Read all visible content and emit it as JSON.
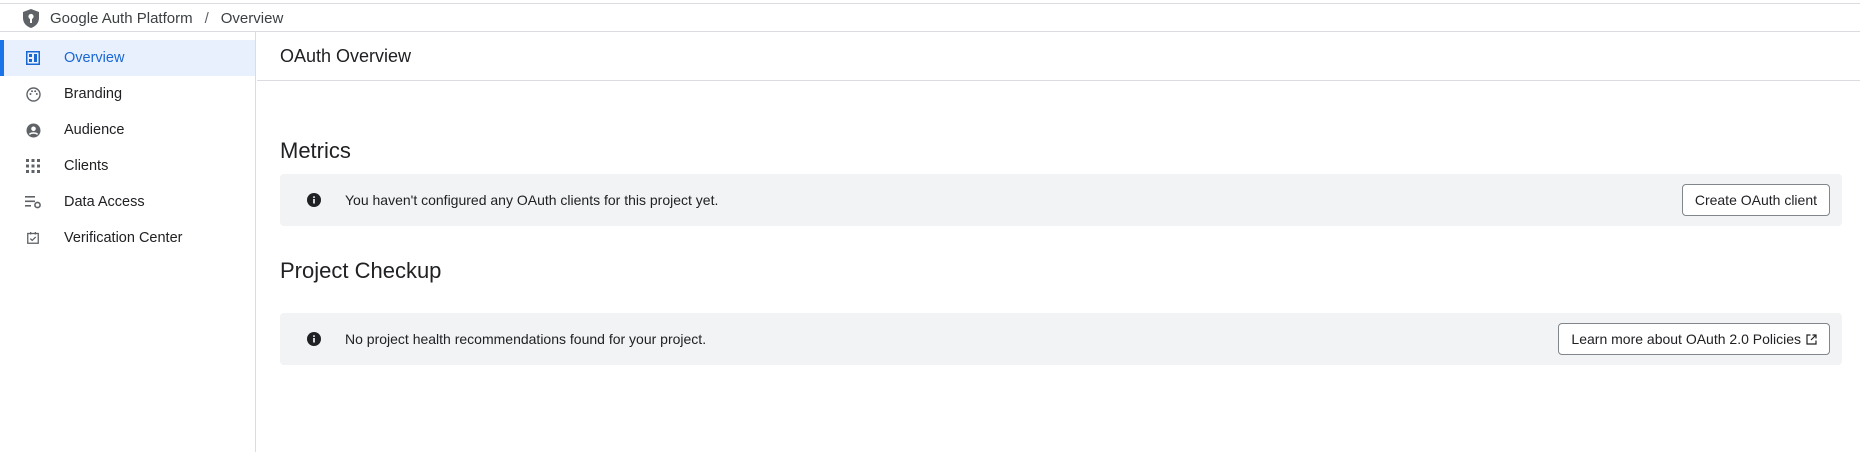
{
  "breadcrumb": {
    "platform": "Google Auth Platform",
    "separator": "/",
    "current": "Overview"
  },
  "sidebar": {
    "items": [
      {
        "label": "Overview",
        "icon": "dashboard-icon",
        "active": true
      },
      {
        "label": "Branding",
        "icon": "palette-icon",
        "active": false
      },
      {
        "label": "Audience",
        "icon": "account-circle-icon",
        "active": false
      },
      {
        "label": "Clients",
        "icon": "apps-grid-icon",
        "active": false
      },
      {
        "label": "Data Access",
        "icon": "data-settings-icon",
        "active": false
      },
      {
        "label": "Verification Center",
        "icon": "checkbox-icon",
        "active": false
      }
    ]
  },
  "main": {
    "title": "OAuth Overview",
    "metrics": {
      "heading": "Metrics",
      "message": "You haven't configured any OAuth clients for this project yet.",
      "button": "Create OAuth client"
    },
    "checkup": {
      "heading": "Project Checkup",
      "message": "No project health recommendations found for your project.",
      "button": "Learn more about OAuth 2.0 Policies"
    }
  },
  "colors": {
    "accent": "#1a73e8",
    "active_bg": "#e8f0fe",
    "banner_bg": "#f1f3f4",
    "border": "#dadce0"
  }
}
